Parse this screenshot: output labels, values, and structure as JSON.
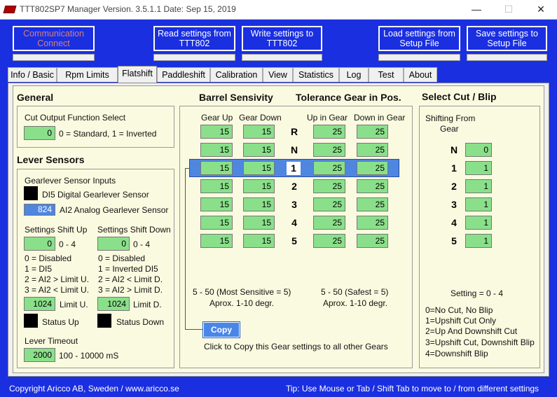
{
  "window": {
    "title": "TTT802SP7 Manager Version. 3.5.1.1  Date: Sep 15, 2019",
    "minimize_icon": "minimize-icon",
    "maximize_icon": "maximize-icon",
    "close_icon": "close-icon"
  },
  "toolbar": {
    "communication_line1": "Communication",
    "communication_line2": "Connect",
    "read_line1": "Read settings from",
    "read_line2": "TTT802",
    "write_line1": "Write settings to",
    "write_line2": "TTT802",
    "load_line1": "Load settings from",
    "load_line2": "Setup File",
    "save_line1": "Save settings to",
    "save_line2": "Setup File"
  },
  "tabs": [
    "Info / Basic",
    "Rpm Limits",
    "Flatshift",
    "Paddleshift",
    "Calibration",
    "View",
    "Statistics",
    "Log",
    "Test",
    "About"
  ],
  "active_tab": "Flatshift",
  "general": {
    "title": "General",
    "cut_output_label": "Cut Output Function Select",
    "cut_output_value": "0",
    "cut_output_hint": "0 = Standard, 1 = Inverted"
  },
  "lever": {
    "title": "Lever Sensors",
    "inputs_label": "Gearlever Sensor Inputs",
    "di5_label": "DI5 Digital Gearlever Sensor",
    "ai2_value": "824",
    "ai2_label": "AI2 Analog Gearlever Sensor",
    "shift_up_title": "Settings Shift Up",
    "shift_down_title": "Settings Shift Down",
    "shift_up_value": "0",
    "shift_down_value": "0",
    "range": "0 - 4",
    "up_options": [
      "0 = Disabled",
      "1 = DI5",
      "2 = AI2 > Limit U.",
      "3 = AI2 < Limit U."
    ],
    "down_options": [
      "0 = Disabled",
      "1 = Inverted DI5",
      "2 = AI2 < Limit D.",
      "3 = AI2 > Limit D."
    ],
    "limit_up_value": "1024",
    "limit_up_label": "Limit U.",
    "limit_down_value": "1024",
    "limit_down_label": "Limit D.",
    "status_up_label": "Status Up",
    "status_down_label": "Status Down",
    "timeout_title": "Lever Timeout",
    "timeout_value": "2000",
    "timeout_hint": "100 - 10000 mS"
  },
  "barrel": {
    "title": "Barrel Sensivity",
    "tolerance_title": "Tolerance Gear in Pos.",
    "col_gear_up": "Gear Up",
    "col_gear_down": "Gear Down",
    "col_up_in_gear": "Up in Gear",
    "col_down_in_gear": "Down in Gear",
    "rows": [
      {
        "gear": "R",
        "up": "15",
        "down": "15",
        "up_in": "25",
        "down_in": "25"
      },
      {
        "gear": "N",
        "up": "15",
        "down": "15",
        "up_in": "25",
        "down_in": "25"
      },
      {
        "gear": "1",
        "up": "15",
        "down": "15",
        "up_in": "25",
        "down_in": "25"
      },
      {
        "gear": "2",
        "up": "15",
        "down": "15",
        "up_in": "25",
        "down_in": "25"
      },
      {
        "gear": "3",
        "up": "15",
        "down": "15",
        "up_in": "25",
        "down_in": "25"
      },
      {
        "gear": "4",
        "up": "15",
        "down": "15",
        "up_in": "25",
        "down_in": "25"
      },
      {
        "gear": "5",
        "up": "15",
        "down": "15",
        "up_in": "25",
        "down_in": "25"
      }
    ],
    "selected_row": 2,
    "sens_hint1": "5 - 50 (Most Sensitive = 5)",
    "sens_hint2": "Aprox. 1-10 degr.",
    "tol_hint1": "5 - 50 (Safest = 5)",
    "tol_hint2": "Aprox. 1-10 degr.",
    "copy_label": "Copy",
    "copy_hint": "Click to Copy this Gear settings to all other Gears"
  },
  "cutblip": {
    "title": "Select Cut / Blip",
    "shifting_from": "Shifting From",
    "gear_label": "Gear",
    "rows": [
      {
        "gear": "N",
        "value": "0"
      },
      {
        "gear": "1",
        "value": "1"
      },
      {
        "gear": "2",
        "value": "1"
      },
      {
        "gear": "3",
        "value": "1"
      },
      {
        "gear": "4",
        "value": "1"
      },
      {
        "gear": "5",
        "value": "1"
      }
    ],
    "setting_label": "Setting = 0 - 4",
    "legend": [
      "0=No Cut, No Blip",
      "1=Upshift Cut Only",
      "2=Up And Downshift Cut",
      "3=Upshift Cut, Downshift Blip",
      "4=Downshift Blip"
    ]
  },
  "status": {
    "copyright": "Copyright Aricco AB, Sweden / www.aricco.se",
    "tip": "Tip:  Use Mouse or Tab / Shift Tab to move to / from  different settings"
  },
  "colors": {
    "background_blue": "#1a2fe0",
    "field_green": "#8ae08a",
    "panel_cream": "#fafae0",
    "selected_row_blue": "#4f86e0"
  }
}
